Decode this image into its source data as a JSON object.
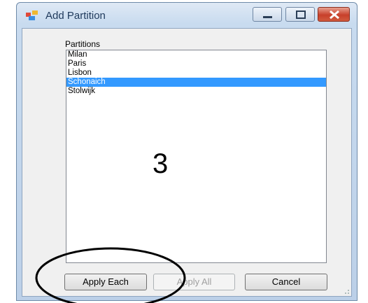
{
  "window": {
    "title": "Add Partition",
    "icons": {
      "app": "application-icon",
      "minimize": "minimize-icon",
      "maximize": "maximize-icon",
      "close": "close-icon"
    }
  },
  "partitions": {
    "label": "Partitions",
    "items": [
      "Milan",
      "Paris",
      "Lisbon",
      "Schonaich",
      "Stolwijk"
    ],
    "selected": "Schonaich"
  },
  "annotation": {
    "number": "3"
  },
  "buttons": {
    "apply_each": "Apply Each",
    "apply_all": "Apply All",
    "cancel": "Cancel"
  },
  "colors": {
    "selection": "#3399ff",
    "close_button": "#c8402b",
    "window_frame": "#c8dbef"
  }
}
